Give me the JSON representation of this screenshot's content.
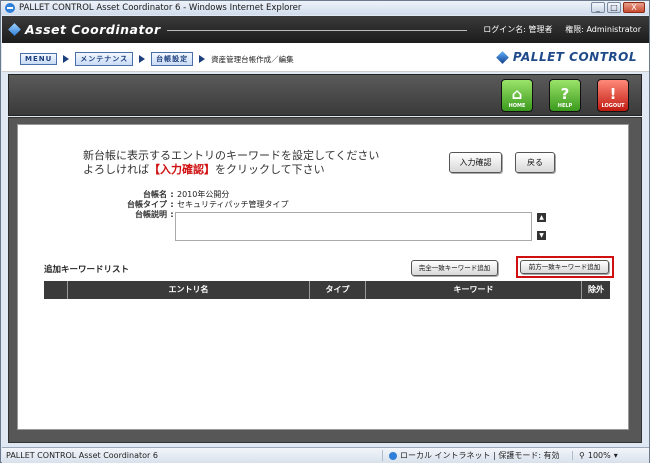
{
  "window": {
    "title": "PALLET CONTROL Asset Coordinator 6 - Windows Internet Explorer",
    "btn_min": "_",
    "btn_max": "□",
    "btn_close": "X"
  },
  "header": {
    "logo": "Asset Coordinator",
    "login_label": "ログイン名:",
    "login_name": "管理者",
    "role_label": "権限:",
    "role_value": "Administrator"
  },
  "breadcrumb": {
    "items": [
      {
        "label": "MENU",
        "type": "button"
      },
      {
        "label": "メンテナンス",
        "type": "button"
      },
      {
        "label": "台帳設定",
        "type": "button"
      },
      {
        "label": "資産管理台帳作成／編集",
        "type": "text"
      }
    ],
    "brand": "PALLET CONTROL"
  },
  "toolbar": {
    "home_label": "HOME",
    "help_label": "HELP",
    "logout_label": "LOGOUT",
    "home_glyph": "⌂",
    "help_glyph": "?",
    "logout_glyph": "!"
  },
  "main": {
    "message_line1": "新台帳に表示するエントリのキーワードを設定してください",
    "message_line2_pre": "よろしければ",
    "message_line2_hl": "【入力確認】",
    "message_line2_post": "をクリックして下さい",
    "confirm_button": "入力確認",
    "back_button": "戻る",
    "ledger_name_label": "台帳名",
    "ledger_name": "2010年公開分",
    "ledger_type_label": "台帳タイプ",
    "ledger_type": "セキュリティパッチ管理タイプ",
    "ledger_desc_label": "台帳説明",
    "ledger_desc": "",
    "colon": ":",
    "list_label": "追加キーワードリスト",
    "exact_match_button": "完全一致キーワード追加",
    "prefix_match_button": "前方一致キーワード追加",
    "table_headers": [
      "",
      "エントリ名",
      "タイプ",
      "キーワード",
      "除外"
    ]
  },
  "statusbar": {
    "left": "PALLET CONTROL Asset Coordinator 6",
    "zone": "ローカル イントラネット | 保護モード: 有効",
    "zoom": "100%"
  }
}
